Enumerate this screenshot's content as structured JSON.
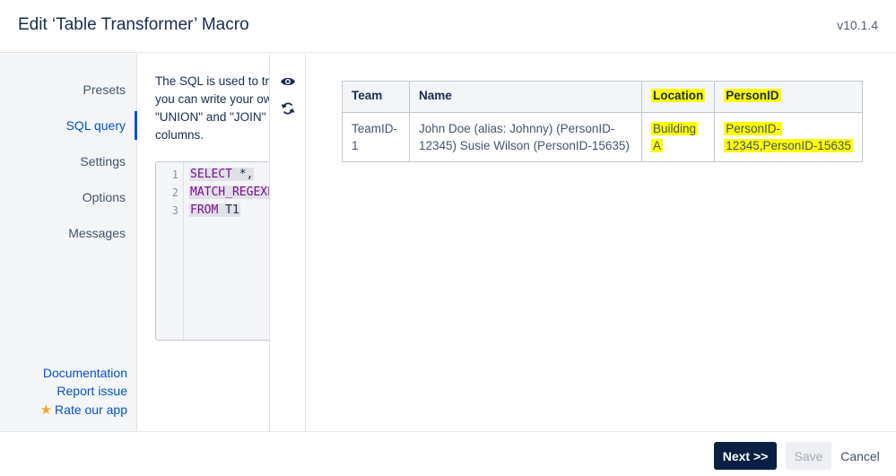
{
  "header": {
    "title": "Edit ‘Table Transformer’ Macro",
    "version": "v10.1.4"
  },
  "sidebar": {
    "items": [
      {
        "label": "Presets"
      },
      {
        "label": "SQL query",
        "active": true
      },
      {
        "label": "Settings"
      },
      {
        "label": "Options"
      },
      {
        "label": "Messages"
      }
    ],
    "links": {
      "documentation": "Documentation",
      "report_issue": "Report issue",
      "rate_app": "Rate our app"
    }
  },
  "sql": {
    "description_lines": [
      "The SQL is used to tra",
      "you can write your ow",
      "\"UNION\" and \"JOIN\"",
      "columns."
    ],
    "line_numbers": [
      "1",
      "2",
      "3"
    ],
    "code": {
      "l1_kw": "SELECT",
      "l1_rest": " *,",
      "l2_kw": "MATCH_REGEXP",
      "l3_kw": "FROM",
      "l3_rest": " T1"
    }
  },
  "toolbar_icons": [
    "eye-icon",
    "refresh-icon"
  ],
  "preview_table": {
    "headers": [
      "Team",
      "Name",
      "Location",
      "PersonID"
    ],
    "rows": [
      {
        "team": "TeamID-1",
        "name": "John Doe (alias: Johnny) (PersonID-12345) Susie Wilson (PersonID-15635)",
        "location_l1": "Building",
        "location_l2": "A",
        "personid_l1": "PersonID-",
        "personid_l2": "12345,PersonID-15635"
      }
    ],
    "highlight_color": "#ffff00"
  },
  "footer": {
    "next_label": "Next >>",
    "save_label": "Save",
    "cancel_label": "Cancel"
  },
  "colors": {
    "primary_button": "#0a1f44",
    "link": "#0052cc",
    "star": "#f5a623"
  }
}
